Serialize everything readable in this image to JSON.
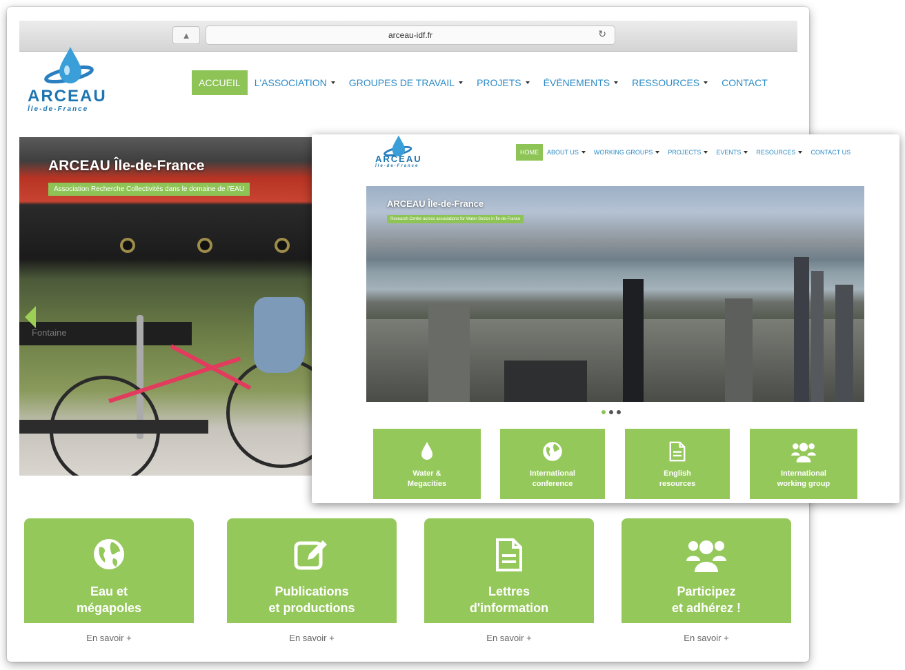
{
  "browser": {
    "url": "arceau-idf.fr",
    "share_icon": "share-icon",
    "reload_icon": "reload-icon"
  },
  "logo": {
    "name": "ARCEAU",
    "subtitle": "Île-de-France"
  },
  "nav_fr": {
    "items": [
      {
        "label": "ACCUEIL",
        "active": true,
        "dropdown": false
      },
      {
        "label": "L'ASSOCIATION",
        "active": false,
        "dropdown": true
      },
      {
        "label": "GROUPES DE TRAVAIL",
        "active": false,
        "dropdown": true
      },
      {
        "label": "PROJETS",
        "active": false,
        "dropdown": true
      },
      {
        "label": "ÉVÉNEMENTS",
        "active": false,
        "dropdown": true
      },
      {
        "label": "RESSOURCES",
        "active": false,
        "dropdown": true
      },
      {
        "label": "CONTACT",
        "active": false,
        "dropdown": false
      }
    ]
  },
  "hero_fr": {
    "title": "ARCEAU Île-de-France",
    "subtitle": "Association Recherche Collectivités dans le domaine de l'EAU",
    "sign_text": "Fontaine"
  },
  "cards_fr": [
    {
      "line1": "Eau et",
      "line2": "mégapoles",
      "icon": "globe-icon",
      "more": "En savoir +"
    },
    {
      "line1": "Publications",
      "line2": "et productions",
      "icon": "edit-icon",
      "more": "En savoir +"
    },
    {
      "line1": "Lettres",
      "line2": "d'information",
      "icon": "document-icon",
      "more": "En savoir +"
    },
    {
      "line1": "Participez",
      "line2": "et adhérez !",
      "icon": "group-icon",
      "more": "En savoir +"
    }
  ],
  "nav_en": {
    "items": [
      {
        "label": "HOME",
        "active": true,
        "dropdown": false
      },
      {
        "label": "ABOUT US",
        "active": false,
        "dropdown": true
      },
      {
        "label": "WORKING GROUPS",
        "active": false,
        "dropdown": true
      },
      {
        "label": "PROJECTS",
        "active": false,
        "dropdown": true
      },
      {
        "label": "EVENTS",
        "active": false,
        "dropdown": true
      },
      {
        "label": "RESOURCES",
        "active": false,
        "dropdown": true
      },
      {
        "label": "CONTACT US",
        "active": false,
        "dropdown": false
      }
    ]
  },
  "hero_en": {
    "title": "ARCEAU Île-de-France",
    "subtitle": "Research Centre across associations for Water Sector in Île-de-France"
  },
  "carousel": {
    "count": 3,
    "active": 1
  },
  "cards_en": [
    {
      "line1": "Water &",
      "line2": "Megacities",
      "icon": "water-drop-icon"
    },
    {
      "line1": "International",
      "line2": "conference",
      "icon": "globe-icon"
    },
    {
      "line1": "English",
      "line2": "resources",
      "icon": "document-icon"
    },
    {
      "line1": "International",
      "line2": "working group",
      "icon": "group-icon"
    }
  ],
  "colors": {
    "brand_green": "#8dc455",
    "card_green": "#95c85b",
    "link_blue": "#2b8ac5",
    "logo_blue": "#1d76b0"
  }
}
